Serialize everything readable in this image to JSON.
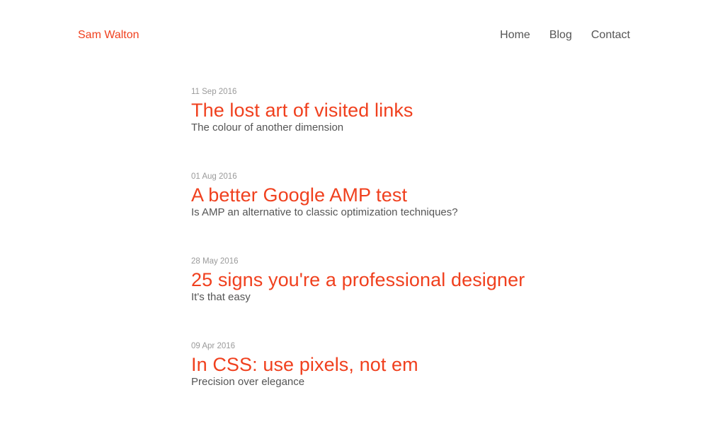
{
  "header": {
    "brand": "Sam Walton",
    "nav": [
      {
        "label": "Home"
      },
      {
        "label": "Blog"
      },
      {
        "label": "Contact"
      }
    ]
  },
  "posts": [
    {
      "date": "11 Sep 2016",
      "title": "The lost art of visited links",
      "subtitle": "The colour of another dimension"
    },
    {
      "date": "01 Aug 2016",
      "title": "A better Google AMP test",
      "subtitle": "Is AMP an alternative to classic optimization techniques?"
    },
    {
      "date": "28 May 2016",
      "title": "25 signs you're a professional designer",
      "subtitle": "It's that easy"
    },
    {
      "date": "09 Apr 2016",
      "title": "In CSS: use pixels, not em",
      "subtitle": "Precision over elegance"
    }
  ],
  "colors": {
    "accent": "#f0401e",
    "text": "#555555",
    "muted": "#9a9a9a",
    "background": "#ffffff"
  }
}
